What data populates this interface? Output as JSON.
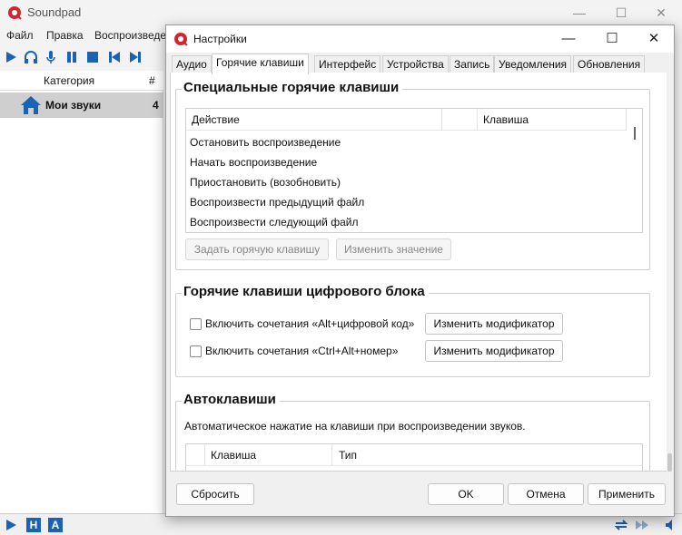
{
  "app": {
    "title": "Soundpad",
    "menu": [
      "Файл",
      "Правка",
      "Воспроизведе"
    ],
    "left_table": {
      "col_category": "Категория",
      "col_count": "#",
      "rows": [
        {
          "label": "Мои звуки",
          "count": "4"
        }
      ]
    },
    "accent_color": "#1a62b5",
    "toolbar_icons": [
      "play-icon",
      "headphones-icon",
      "microphone-icon",
      "pause-icon",
      "stop-icon",
      "previous-icon",
      "next-icon"
    ],
    "status_icons": [
      "play-icon",
      "h-icon",
      "a-icon",
      "repeat-icon",
      "forward-icon",
      "volume-icon"
    ],
    "status_labels": {
      "h": "H",
      "a": "A"
    }
  },
  "dialog": {
    "title": "Настройки",
    "tabs": [
      "Аудио",
      "Горячие клавиши",
      "Интерфейс",
      "Устройства",
      "Запись",
      "Уведомления",
      "Обновления"
    ],
    "active_tab": "Горячие клавиши",
    "special_hotkeys": {
      "title": "Специальные горячие клавиши",
      "col_action": "Действие",
      "col_key": "Клавиша",
      "rows": [
        "Остановить воспроизведение",
        "Начать воспроизведение",
        "Приостановить (возобновить)",
        "Воспроизвести предыдущий файл",
        "Воспроизвести следующий файл"
      ],
      "set_hotkey_button": "Задать горячую клавишу",
      "change_value_button": "Изменить значение"
    },
    "numpad_hotkeys": {
      "title": "Горячие клавиши цифрового блока",
      "option1": "Включить сочетания «Alt+цифровой код»",
      "option2": "Включить сочетания «Ctrl+Alt+номер»",
      "option1_checked": false,
      "option2_checked": false,
      "change_modifier_button": "Изменить модификатор"
    },
    "autokeys": {
      "title": "Автоклавиши",
      "description": "Автоматическое нажатие на клавиши при воспроизведении звуков.",
      "col_key": "Клавиша",
      "col_type": "Тип"
    },
    "footer": {
      "reset": "Сбросить",
      "ok": "OK",
      "cancel": "Отмена",
      "apply": "Применить"
    }
  }
}
